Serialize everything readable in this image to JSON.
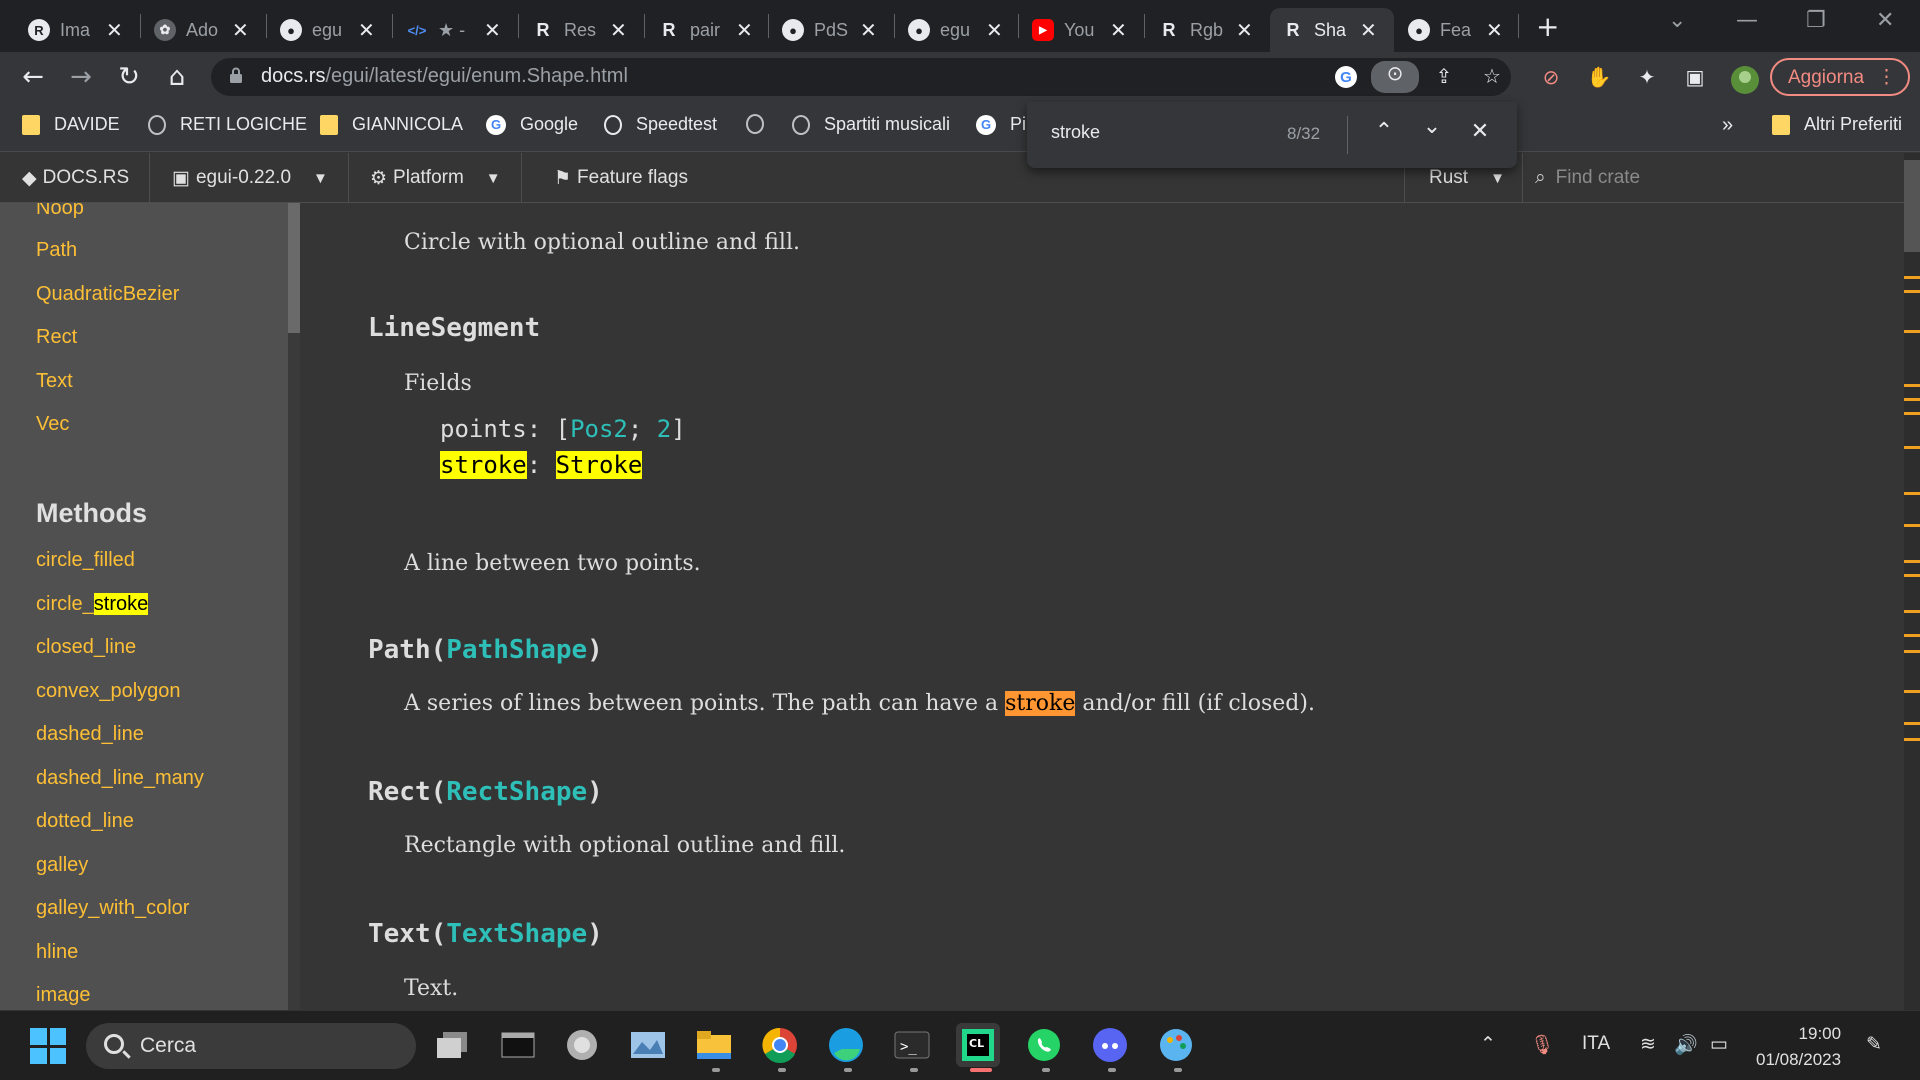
{
  "browser": {
    "tabs": [
      {
        "label": "Ima",
        "icon": "rust-logo-icon"
      },
      {
        "label": "Ado",
        "icon": "openai-icon"
      },
      {
        "label": "egu",
        "icon": "github-icon"
      },
      {
        "label": "★ -",
        "icon": "code-icon"
      },
      {
        "label": "Res",
        "icon": "rust-docs-icon"
      },
      {
        "label": "pair",
        "icon": "rust-docs-icon"
      },
      {
        "label": "PdS",
        "icon": "github-icon"
      },
      {
        "label": "egu",
        "icon": "github-icon"
      },
      {
        "label": "You",
        "icon": "youtube-icon"
      },
      {
        "label": "Rgb",
        "icon": "rust-docs-icon"
      },
      {
        "label": "Sha",
        "icon": "rust-docs-icon",
        "active": true
      },
      {
        "label": "Fea",
        "icon": "github-icon"
      }
    ],
    "url_host": "docs.rs",
    "url_path": "/egui/latest/egui/enum.Shape.html",
    "update_label": "Aggiorna",
    "bookmarks": [
      {
        "label": "DAVIDE",
        "icon": "folder-icon"
      },
      {
        "label": "RETI LOGICHE",
        "icon": "globe-icon"
      },
      {
        "label": "GIANNICOLA",
        "icon": "folder-icon"
      },
      {
        "label": "Google",
        "icon": "google-icon"
      },
      {
        "label": "Speedtest",
        "icon": "speedtest-icon"
      },
      {
        "label": "",
        "icon": "globe-icon"
      },
      {
        "label": "Spartiti musicali",
        "icon": "globe-icon"
      },
      {
        "label": "Pi",
        "icon": "google-icon"
      }
    ],
    "more_bookmarks": "»",
    "other_bookmarks": "Altri Preferiti",
    "find": {
      "query": "stroke",
      "count": "8/32"
    }
  },
  "docs_nav": {
    "logo": "DOCS.RS",
    "crate": "egui-0.22.0",
    "platform": "Platform",
    "feature_flags": "Feature flags",
    "rust": "Rust",
    "find_crate_placeholder": "Find crate"
  },
  "sidebar": {
    "variants_tail": [
      "Noop",
      "Path",
      "QuadraticBezier",
      "Rect",
      "Text",
      "Vec"
    ],
    "methods_title": "Methods",
    "methods": [
      "circle_filled",
      "circle_",
      "closed_line",
      "convex_polygon",
      "dashed_line",
      "dashed_line_many",
      "dotted_line",
      "galley",
      "galley_with_color",
      "hline",
      "image"
    ],
    "methods_hl": "stroke"
  },
  "content": {
    "circle_desc": "Circle with optional outline and fill.",
    "line_segment": {
      "name": "LineSegment",
      "fields_title": "Fields",
      "field1_name": "points",
      "field1_colon": ":",
      "field1_open": "[",
      "field1_type": "Pos2",
      "field1_sep": ";",
      "field1_len": "2",
      "field1_close": "]",
      "field2_name": "stroke",
      "field2_colon": ":",
      "field2_type": "Stroke",
      "desc": "A line between two points."
    },
    "path": {
      "name": "Path",
      "type": "PathShape",
      "desc_before": "A series of lines between points. The path can have a ",
      "desc_hl": "stroke",
      "desc_after": " and/or fill (if closed)."
    },
    "rect": {
      "name": "Rect",
      "type": "RectShape",
      "desc": "Rectangle with optional outline and fill."
    },
    "text": {
      "name": "Text",
      "type": "TextShape",
      "desc": "Text."
    },
    "paren_open": "(",
    "paren_close": ")"
  },
  "taskbar": {
    "search_label": "Cerca",
    "lang": "ITA",
    "time": "19:00",
    "date": "01/08/2023"
  }
}
